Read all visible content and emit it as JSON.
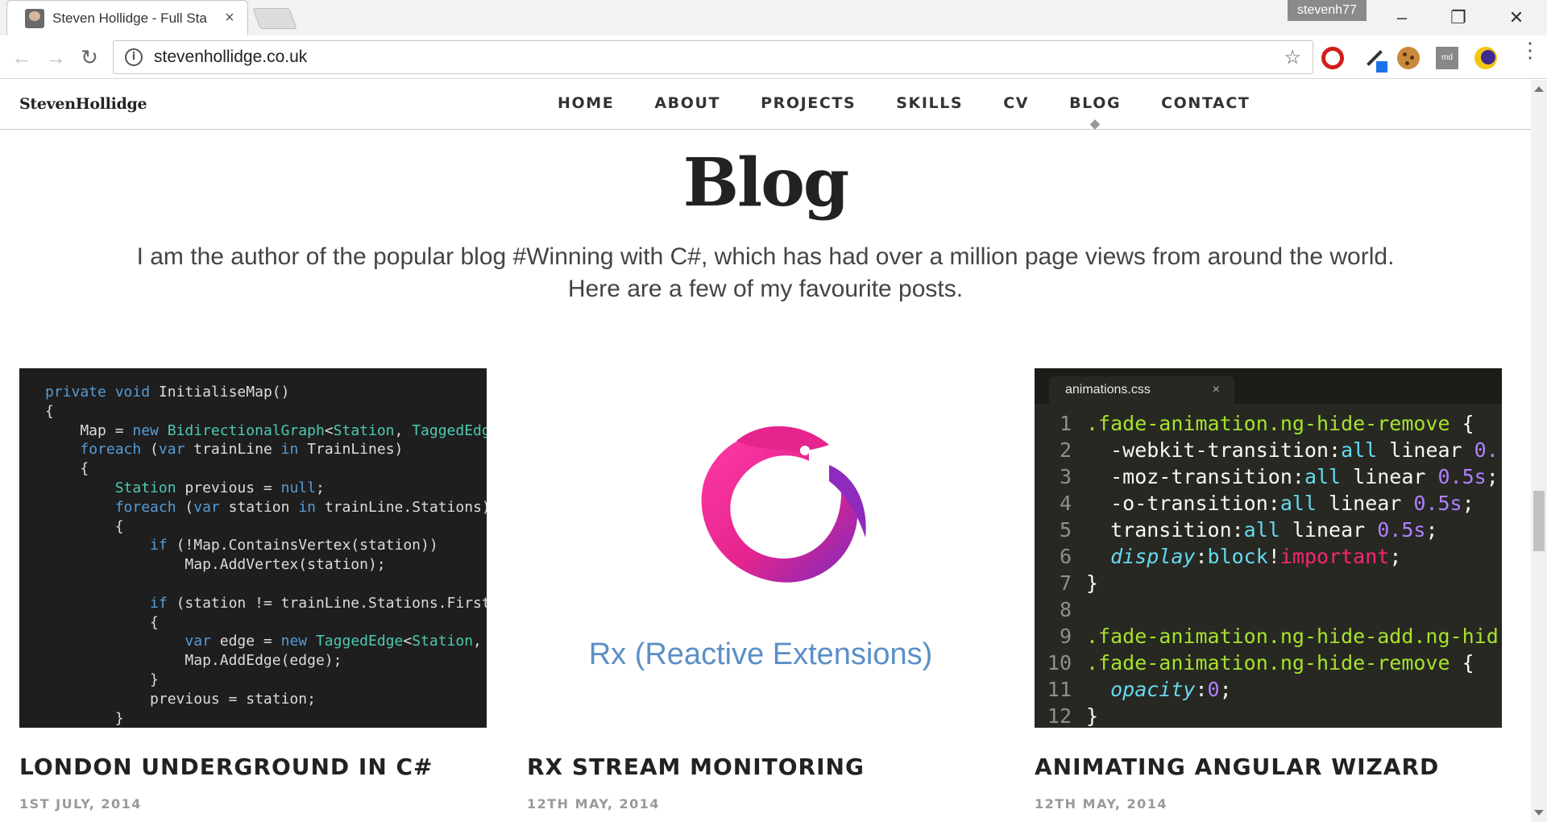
{
  "browser": {
    "tab_title": "Steven Hollidge - Full Sta",
    "tab_close": "×",
    "profile": "stevenh77",
    "url": "stevenhollidge.co.uk",
    "window_controls": {
      "minimize": "–",
      "restore": "❐",
      "close": "✕"
    },
    "nav": {
      "back": "←",
      "forward": "→",
      "reload": "↻"
    },
    "info_glyph": "i",
    "star_glyph": "☆",
    "ext_md_label": "md",
    "menu_glyph": "⋮",
    "extensions": [
      "opera-icon",
      "eyedropper-icon",
      "cookie-icon",
      "markdown-icon",
      "moon-icon"
    ]
  },
  "site": {
    "brand": "StevenHollidge",
    "nav": [
      "HOME",
      "ABOUT",
      "PROJECTS",
      "SKILLS",
      "CV",
      "BLOG",
      "CONTACT"
    ],
    "active_nav": "BLOG",
    "heading": "Blog",
    "intro_line1": "I am the author of the popular blog #Winning with C#, which has had over a million page views from around the world.",
    "intro_line2": "Here are a few of my favourite posts."
  },
  "posts": [
    {
      "title": "LONDON UNDERGROUND IN C#",
      "date": "1ST JULY, 2014"
    },
    {
      "title": "RX STREAM MONITORING",
      "date": "12TH MAY, 2014",
      "image_caption": "Rx (Reactive Extensions)"
    },
    {
      "title": "ANIMATING ANGULAR WIZARD",
      "date": "12TH MAY, 2014",
      "editor_tab": "animations.css"
    }
  ],
  "code_csharp": [
    "private void InitialiseMap()",
    "{",
    "    Map = new BidirectionalGraph<Station, TaggedEdge<",
    "    foreach (var trainLine in TrainLines)",
    "    {",
    "        Station previous = null;",
    "        foreach (var station in trainLine.Stations)",
    "        {",
    "            if (!Map.ContainsVertex(station))",
    "                Map.AddVertex(station);",
    "",
    "            if (station != trainLine.Stations.First()",
    "            {",
    "                var edge = new TaggedEdge<Station, Tr",
    "                Map.AddEdge(edge);",
    "            }",
    "            previous = station;",
    "        }"
  ],
  "code_css": [
    {
      "n": "1",
      "text": ".fade-animation.ng-hide-remove {"
    },
    {
      "n": "2",
      "text": "  -webkit-transition:all linear 0."
    },
    {
      "n": "3",
      "text": "  -moz-transition:all linear 0.5s;"
    },
    {
      "n": "4",
      "text": "  -o-transition:all linear 0.5s;"
    },
    {
      "n": "5",
      "text": "  transition:all linear 0.5s;"
    },
    {
      "n": "6",
      "text": "  display:block!important;"
    },
    {
      "n": "7",
      "text": "}"
    },
    {
      "n": "8",
      "text": ""
    },
    {
      "n": "9",
      "text": ".fade-animation.ng-hide-add.ng-hid"
    },
    {
      "n": "10",
      "text": ".fade-animation.ng-hide-remove {"
    },
    {
      "n": "11",
      "text": "  opacity:0;"
    },
    {
      "n": "12",
      "text": "}"
    }
  ],
  "colors": {
    "rx_pink": "#e6248e",
    "rx_purple": "#7b2bbd",
    "rx_caption": "#5b8fc7",
    "editor_bg": "#272822"
  }
}
